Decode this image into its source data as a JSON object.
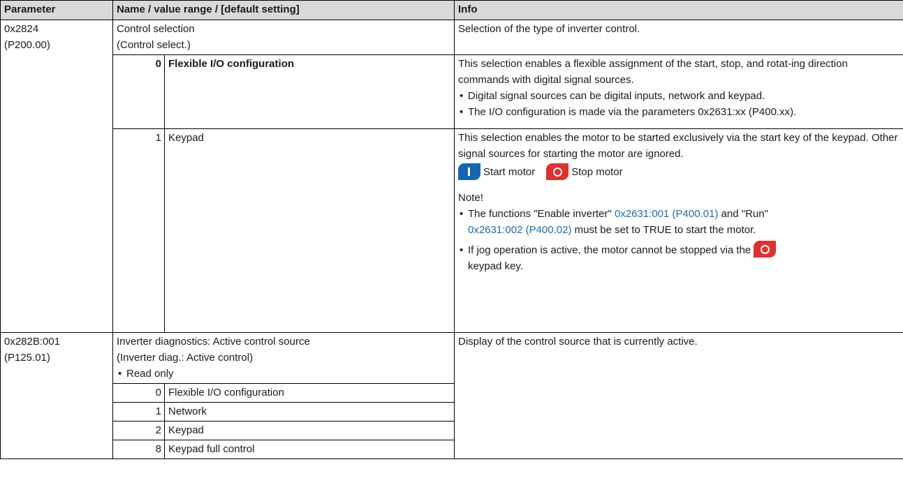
{
  "header": {
    "parameter": "Parameter",
    "name": "Name / value range / [default setting]",
    "info": "Info"
  },
  "param1": {
    "index": "0x2824",
    "code": "(P200.00)",
    "name": "Control selection",
    "short": "(Control select.)",
    "info": "Selection of the type of inverter control.",
    "options": [
      {
        "value": "0",
        "label": "Flexible I/O configuration",
        "desc": "This selection enables a flexible assignment of the start, stop, and rotat-ing direction commands with digital signal sources.",
        "bullets": [
          "Digital signal sources can be digital inputs, network and keypad.",
          "The I/O configuration is made via the parameters 0x2631:xx (P400.xx)."
        ]
      },
      {
        "value": "1",
        "label": "Keypad",
        "desc": "This selection enables the motor to be started exclusively via the start key of the keypad. Other signal sources for starting the motor are ignored.",
        "start_label": "Start motor",
        "stop_label": "Stop motor",
        "note_title": "Note!",
        "note1_a": "The functions \"Enable inverter\" ",
        "note1_link1": "0x2631:001 (P400.01)",
        "note1_b": " and \"Run\"",
        "note1_link2": "0x2631:002 (P400.02)",
        "note1_c": " must be set to TRUE to start the motor.",
        "note2_a": "If jog operation is active, the motor cannot be stopped via the",
        "note2_b": "keypad key."
      }
    ]
  },
  "param2": {
    "index": "0x282B:001",
    "code": "(P125.01)",
    "name": "Inverter diagnostics: Active control source",
    "short": "(Inverter diag.: Active control)",
    "bullet": "Read only",
    "info": "Display of the control source that is currently active.",
    "options": [
      {
        "value": "0",
        "label": "Flexible I/O configuration"
      },
      {
        "value": "1",
        "label": "Network"
      },
      {
        "value": "2",
        "label": "Keypad"
      },
      {
        "value": "8",
        "label": "Keypad full control"
      }
    ]
  },
  "colors": {
    "link": "#1a6cb8",
    "start_key": "#1565b4",
    "stop_key": "#e2302e",
    "header_bg": "#d9d9d9"
  },
  "icons": {
    "start": "start-key-icon",
    "stop": "stop-key-icon"
  }
}
